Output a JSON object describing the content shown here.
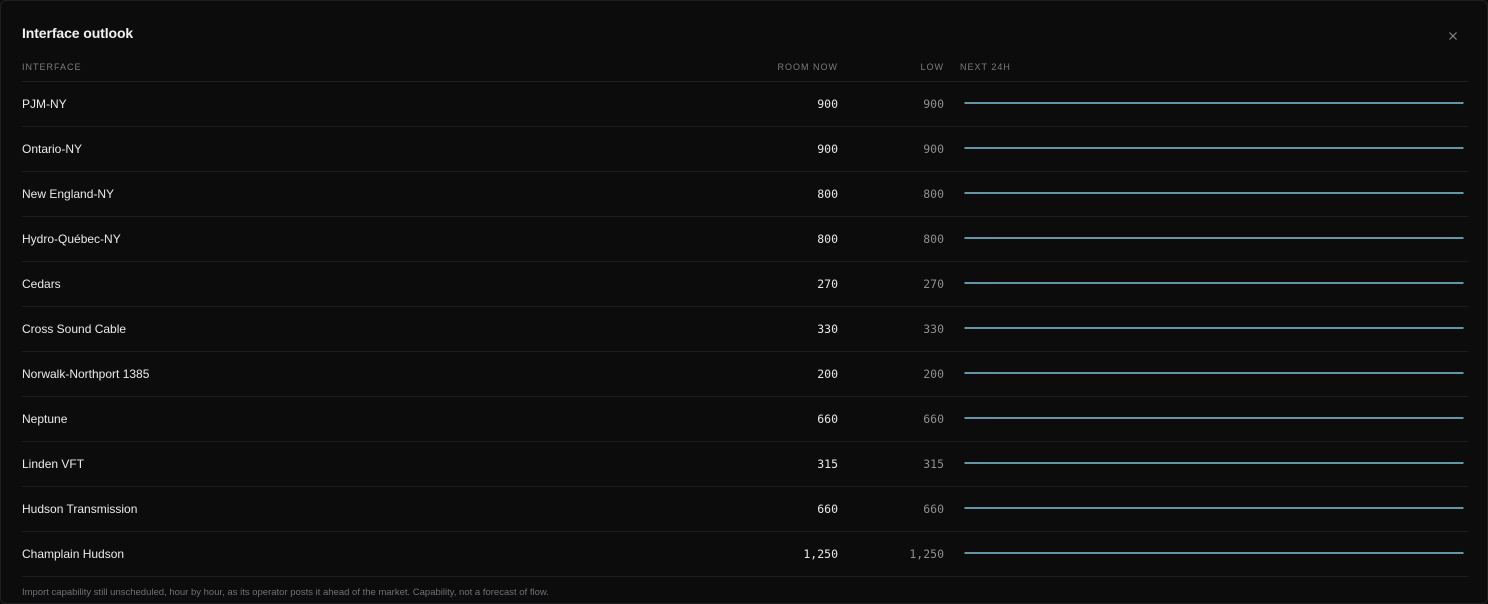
{
  "panel": {
    "title": "Interface outlook",
    "close_icon": "close-icon"
  },
  "columns": {
    "interface": "INTERFACE",
    "room_now": "ROOM NOW",
    "low": "LOW",
    "next_24h": "NEXT 24H"
  },
  "colors": {
    "spark_line": "#7fc3d9",
    "background": "#0c0c0d"
  },
  "rows": [
    {
      "name": "PJM-NY",
      "room_now": "900",
      "low": "900",
      "series": [
        1,
        1
      ]
    },
    {
      "name": "Ontario-NY",
      "room_now": "900",
      "low": "900",
      "series": [
        1,
        1
      ]
    },
    {
      "name": "New England-NY",
      "room_now": "800",
      "low": "800",
      "series": [
        1,
        1
      ]
    },
    {
      "name": "Hydro-Québec-NY",
      "room_now": "800",
      "low": "800",
      "series": [
        1,
        1
      ]
    },
    {
      "name": "Cedars",
      "room_now": "270",
      "low": "270",
      "series": [
        1,
        1
      ]
    },
    {
      "name": "Cross Sound Cable",
      "room_now": "330",
      "low": "330",
      "series": [
        1,
        1
      ]
    },
    {
      "name": "Norwalk-Northport 1385",
      "room_now": "200",
      "low": "200",
      "series": [
        1,
        1
      ]
    },
    {
      "name": "Neptune",
      "room_now": "660",
      "low": "660",
      "series": [
        1,
        1
      ]
    },
    {
      "name": "Linden VFT",
      "room_now": "315",
      "low": "315",
      "series": [
        1,
        1
      ]
    },
    {
      "name": "Hudson Transmission",
      "room_now": "660",
      "low": "660",
      "series": [
        1,
        1
      ]
    },
    {
      "name": "Champlain Hudson",
      "room_now": "1,250",
      "low": "1,250",
      "series": [
        1,
        1
      ]
    }
  ],
  "footnote": "Import capability still unscheduled, hour by hour, as its operator posts it ahead of the market. Capability, not a forecast of flow."
}
